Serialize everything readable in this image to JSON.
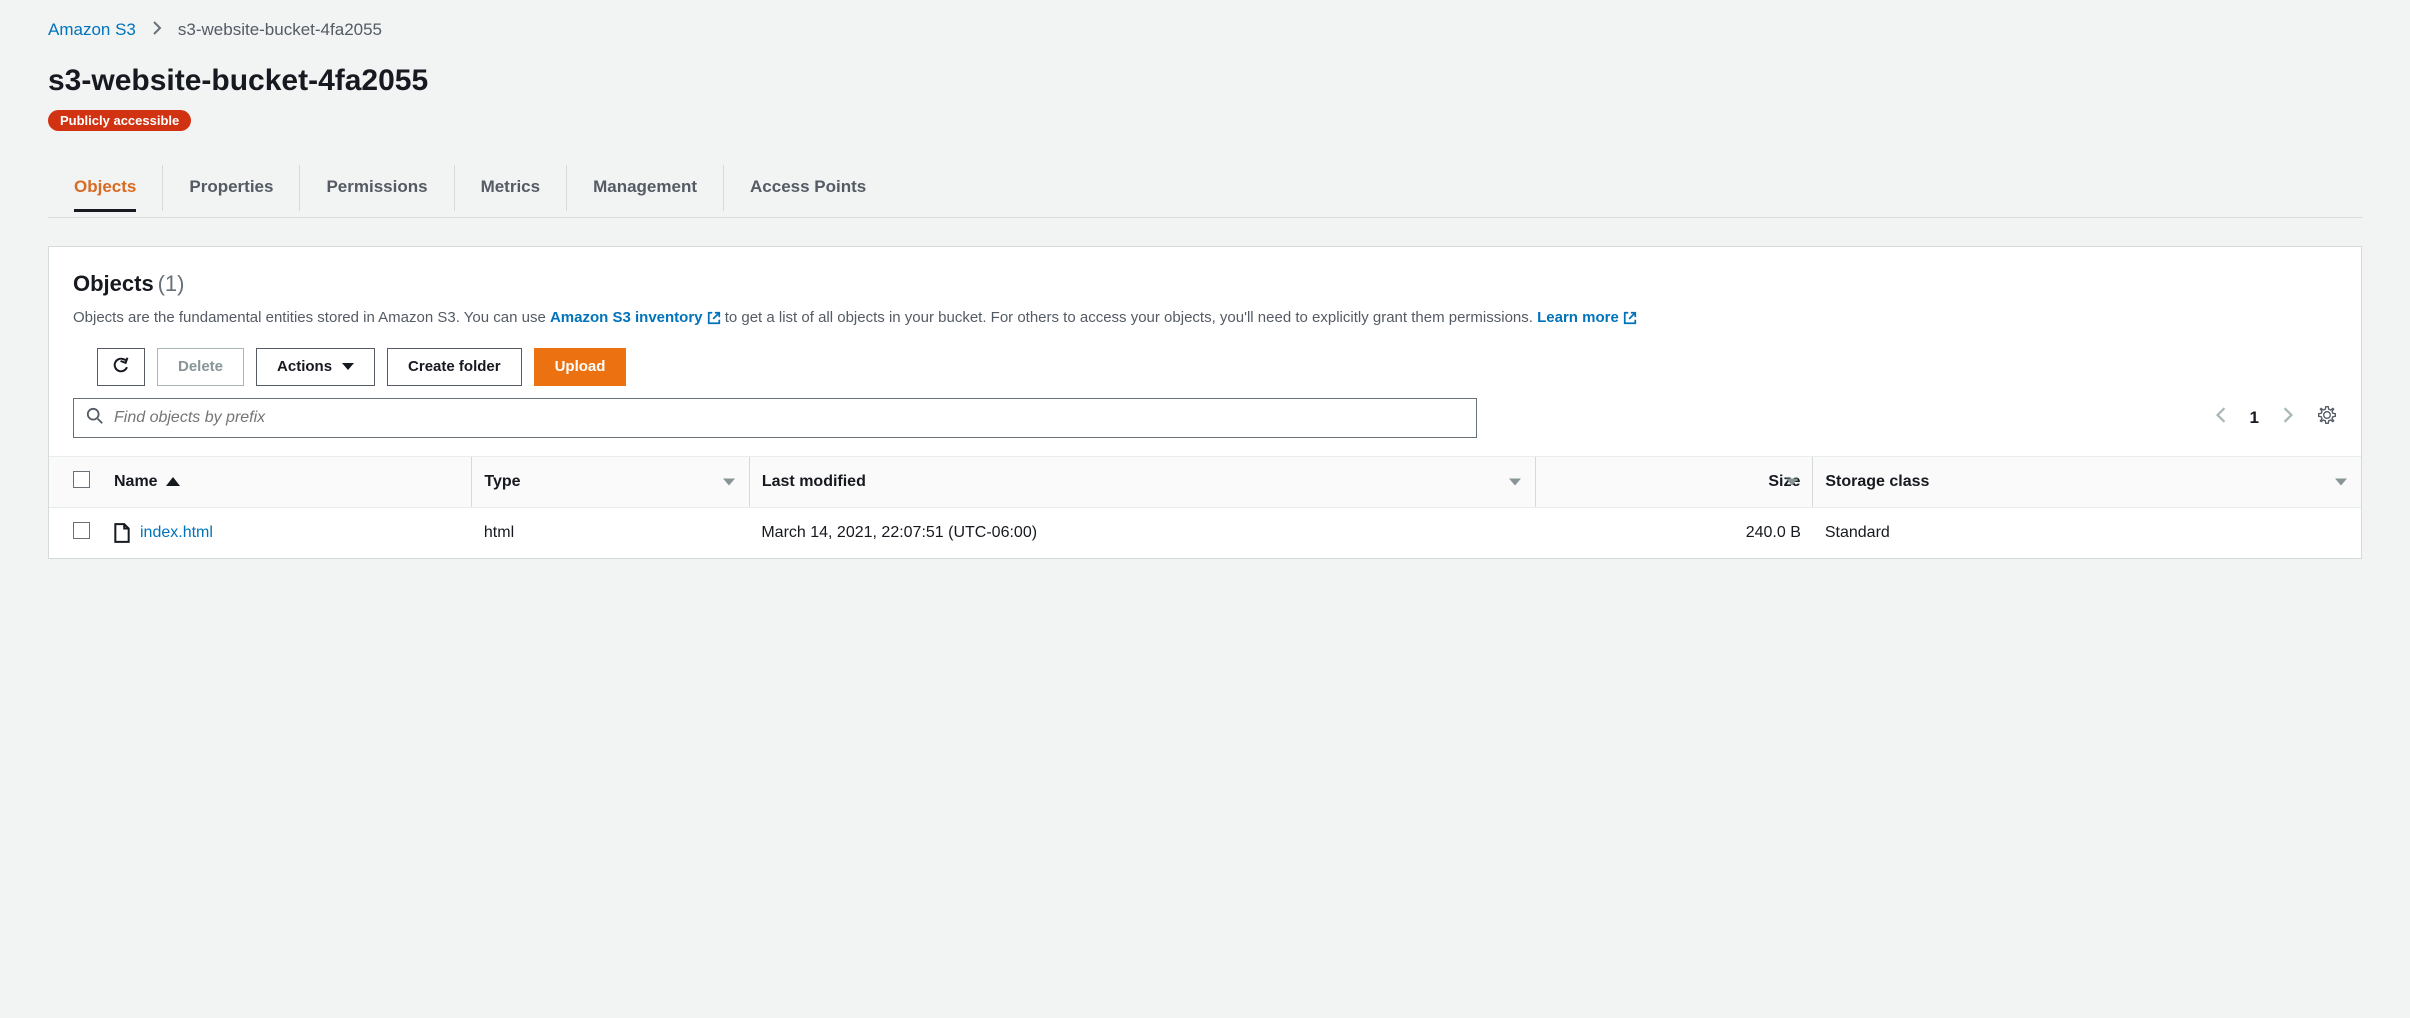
{
  "breadcrumb": {
    "root": "Amazon S3",
    "current": "s3-website-bucket-4fa2055"
  },
  "header": {
    "title": "s3-website-bucket-4fa2055",
    "badge": "Publicly accessible"
  },
  "tabs": [
    {
      "label": "Objects",
      "active": true
    },
    {
      "label": "Properties",
      "active": false
    },
    {
      "label": "Permissions",
      "active": false
    },
    {
      "label": "Metrics",
      "active": false
    },
    {
      "label": "Management",
      "active": false
    },
    {
      "label": "Access Points",
      "active": false
    }
  ],
  "panel": {
    "title": "Objects",
    "count": "(1)",
    "desc_before": "Objects are the fundamental entities stored in Amazon S3. You can use ",
    "inventory_link": "Amazon S3 inventory",
    "desc_middle": " to get a list of all objects in your bucket. For others to access your objects, you'll need to explicitly grant them permissions. ",
    "learn_more": "Learn more"
  },
  "toolbar": {
    "delete": "Delete",
    "actions": "Actions",
    "create_folder": "Create folder",
    "upload": "Upload"
  },
  "search": {
    "placeholder": "Find objects by prefix"
  },
  "pagination": {
    "page": "1"
  },
  "columns": {
    "name": "Name",
    "type": "Type",
    "last_modified": "Last modified",
    "size": "Size",
    "storage_class": "Storage class"
  },
  "rows": [
    {
      "name": "index.html",
      "type": "html",
      "last_modified": "March 14, 2021, 22:07:51 (UTC-06:00)",
      "size": "240.0 B",
      "storage_class": "Standard"
    }
  ]
}
